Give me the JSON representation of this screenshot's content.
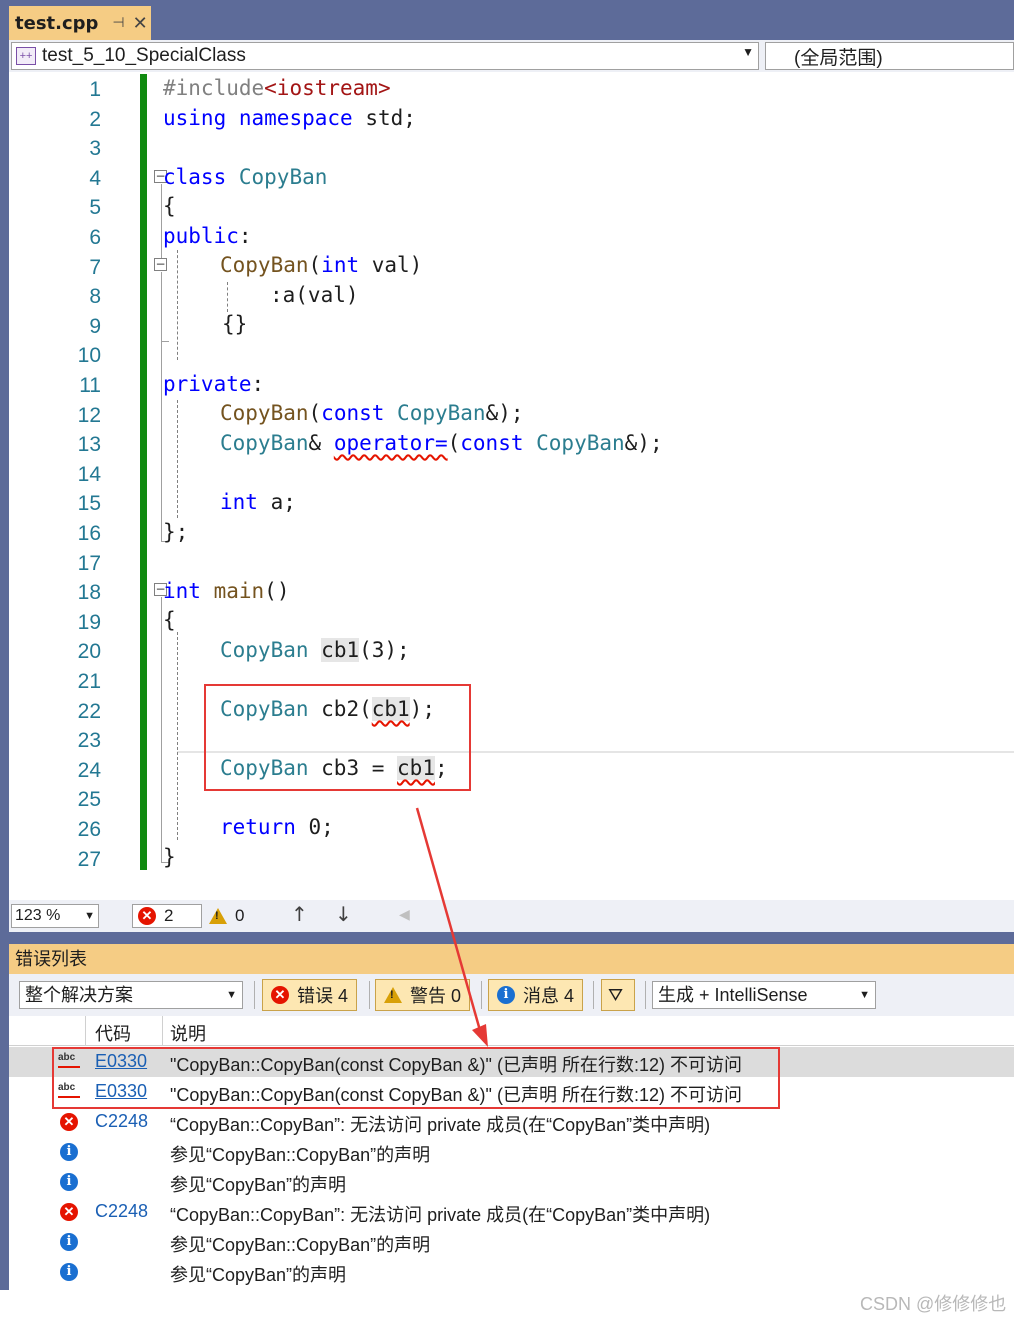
{
  "tab": {
    "title": "test.cpp",
    "pin_icon": "pin-icon",
    "close_icon": "close-icon"
  },
  "nav": {
    "project": "test_5_10_SpecialClass",
    "scope": "(全局范围)"
  },
  "editor": {
    "lines": [
      "1",
      "2",
      "3",
      "4",
      "5",
      "6",
      "7",
      "8",
      "9",
      "10",
      "11",
      "12",
      "13",
      "14",
      "15",
      "16",
      "17",
      "18",
      "19",
      "20",
      "21",
      "22",
      "23",
      "24",
      "25",
      "26",
      "27"
    ],
    "code": {
      "l1_pp": "#include",
      "l1_inc": "<iostream>",
      "l2_kw1": "using",
      "l2_kw2": "namespace",
      "l2_rest": "std;",
      "l4_kw": "class",
      "l4_ty": "CopyBan",
      "l5": "{",
      "l6_kw": "public",
      "l6_rest": ":",
      "l7_fn": "CopyBan",
      "l7_p1": "(",
      "l7_kw": "int",
      "l7_rest": " val)",
      "l8": ":a(val)",
      "l9": "{}",
      "l11_kw": "private",
      "l11_rest": ":",
      "l12_fn": "CopyBan",
      "l12_p1": "(",
      "l12_kw": "const",
      "l12_ty": "CopyBan",
      "l12_rest": "&);",
      "l13_ty": "CopyBan",
      "l13_amp": "& ",
      "l13_op": "operator=",
      "l13_p1": "(",
      "l13_kw": "const",
      "l13_ty2": "CopyBan",
      "l13_rest": "&);",
      "l15_kw": "int",
      "l15_rest": " a;",
      "l16": "};",
      "l18_kw": "int",
      "l18_fn": "main",
      "l18_rest": "()",
      "l19": "{",
      "l20_ty": "CopyBan",
      "l20_var": "cb1",
      "l20_rest": "(3);",
      "l22_ty": "CopyBan",
      "l22_a": " cb2(",
      "l22_var": "cb1",
      "l22_rest": ");",
      "l24_ty": "CopyBan",
      "l24_a": " cb3 = ",
      "l24_var": "cb1",
      "l24_rest": ";",
      "l26_kw": "return",
      "l26_rest": " 0;",
      "l27": "}"
    }
  },
  "status": {
    "zoom": "123 %",
    "errors": "2",
    "warnings": "0"
  },
  "error_list": {
    "title": "错误列表",
    "scope": "整个解决方案",
    "btn_errors": "错误 4",
    "btn_warnings": "警告 0",
    "btn_messages": "消息 4",
    "source": "生成 + IntelliSense",
    "col_code": "代码",
    "col_desc": "说明",
    "rows": [
      {
        "code": "E0330",
        "desc": "\"CopyBan::CopyBan(const CopyBan &)\" (已声明 所在行数:12) 不可访问"
      },
      {
        "code": "E0330",
        "desc": "\"CopyBan::CopyBan(const CopyBan &)\" (已声明 所在行数:12) 不可访问"
      },
      {
        "code": "C2248",
        "desc": "“CopyBan::CopyBan”: 无法访问 private 成员(在“CopyBan”类中声明)"
      },
      {
        "code": "",
        "desc": "参见“CopyBan::CopyBan”的声明"
      },
      {
        "code": "",
        "desc": "参见“CopyBan”的声明"
      },
      {
        "code": "C2248",
        "desc": "“CopyBan::CopyBan”: 无法访问 private 成员(在“CopyBan”类中声明)"
      },
      {
        "code": "",
        "desc": "参见“CopyBan::CopyBan”的声明"
      },
      {
        "code": "",
        "desc": "参见“CopyBan”的声明"
      }
    ]
  },
  "watermark": "CSDN @修修修也",
  "colors": {
    "accent_tab": "#f5cc84",
    "frame": "#5d6b99",
    "error_red": "#e51400",
    "annotation_red": "#e53935",
    "change_bar": "#108a10"
  }
}
